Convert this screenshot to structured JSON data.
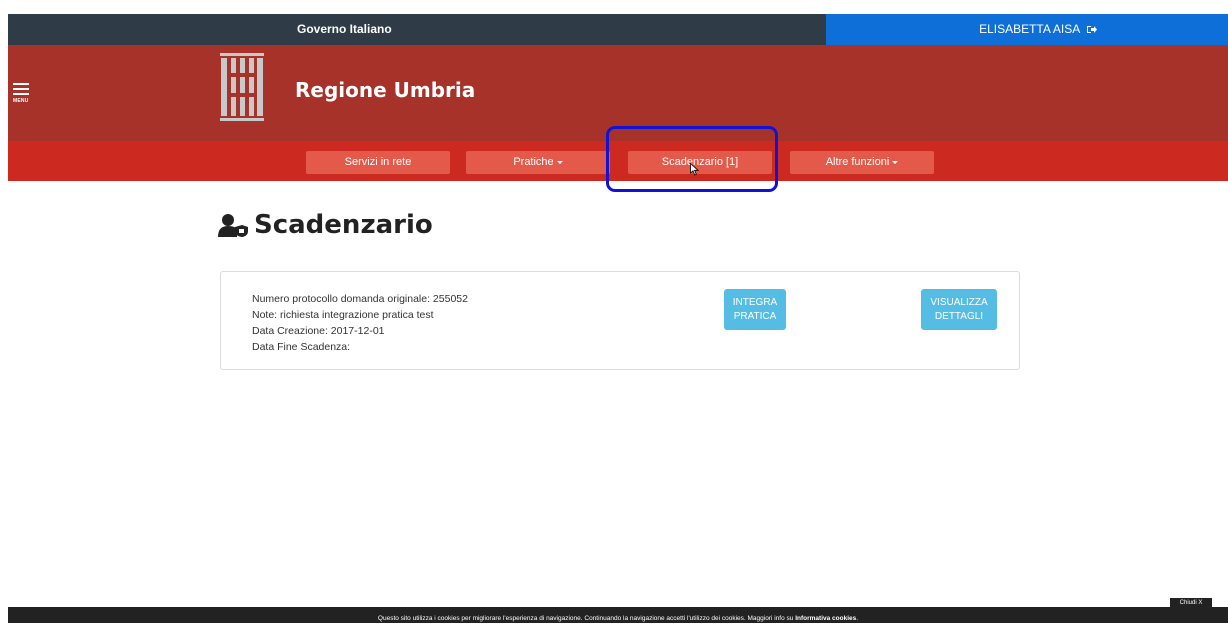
{
  "topbar": {
    "gov_label": "Governo Italiano",
    "user_name": "ELISABETTA AISA"
  },
  "header": {
    "menu_label": "MENU",
    "brand": "Regione Umbria"
  },
  "nav": {
    "items": [
      {
        "label": "Servizi in rete",
        "dropdown": false
      },
      {
        "label": "Pratiche",
        "dropdown": true
      },
      {
        "label": "Scadenzario [1]",
        "dropdown": false
      },
      {
        "label": "Altre funzioni",
        "dropdown": true
      }
    ]
  },
  "page": {
    "title": "Scadenzario"
  },
  "card": {
    "lines": [
      "Numero protocollo domanda originale: 255052",
      "Note: richiesta integrazione pratica test",
      "Data Creazione: 2017-12-01",
      "Data Fine Scadenza:"
    ],
    "integra_label_1": "INTEGRA",
    "integra_label_2": "PRATICA",
    "visualizza_label_1": "VISUALIZZA",
    "visualizza_label_2": "DETTAGLI"
  },
  "cookie": {
    "text": "Questo sito utilizza i cookies per migliorare l'esperienza di navigazione. Continuando la navigazione accetti l'utilizzo dei cookies. Maggiori info su ",
    "link": "Informativa cookies",
    "after_link": ".",
    "close_label": "Chiudi X"
  },
  "colors": {
    "topbar": "#2f3b46",
    "user_bar": "#0e6fd8",
    "header": "#a6322a",
    "navbar": "#cc2a20",
    "nav_button": "#e35a4a",
    "action_button": "#55bde4",
    "highlight": "#1212d6"
  },
  "icons": {
    "menu": "hamburger-icon",
    "logout": "logout-icon",
    "logo": "regione-umbria-logo",
    "title": "user-shield-icon",
    "caret": "caret-down-icon"
  }
}
